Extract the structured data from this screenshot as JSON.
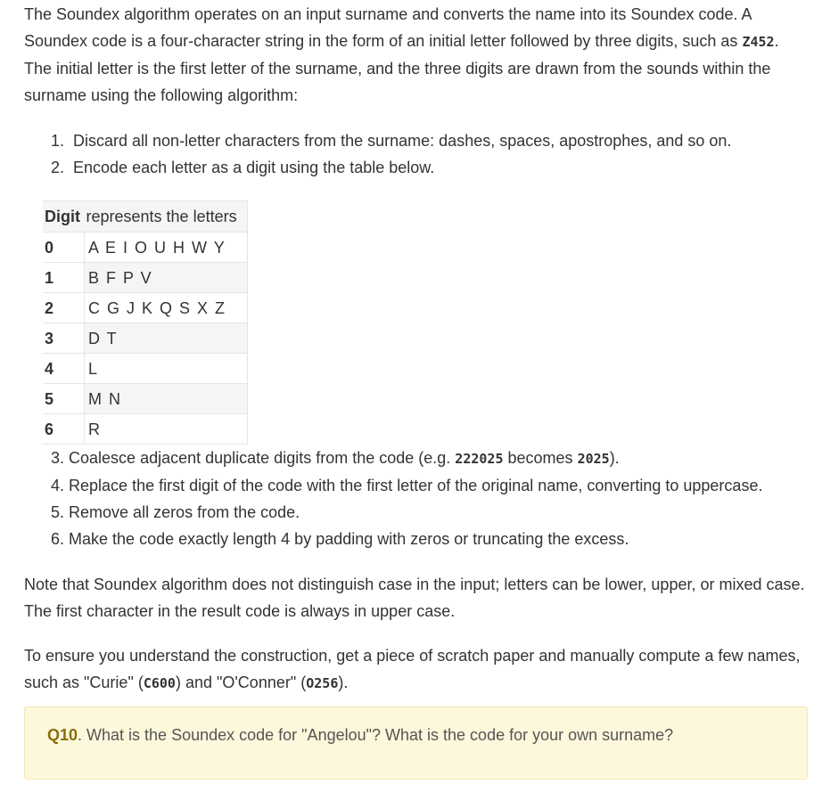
{
  "intro": {
    "p1": "The Soundex algorithm operates on an input surname and converts the name into its Soundex code. A Soundex code is a four-character string in the form of an initial letter followed by three digits, such as",
    "example_code": "Z452",
    "p2": ". The initial letter is the first letter of the surname, and the three digits are drawn from the sounds within the surname using the following algorithm:"
  },
  "steps_before": [
    {
      "num": "1.",
      "text": "Discard all non-letter characters from the surname: dashes, spaces, apostrophes, and so on."
    },
    {
      "num": "2.",
      "text": "Encode each letter as a digit using the table below."
    }
  ],
  "table": {
    "header_digit": "Digit",
    "header_letters": "represents the letters",
    "rows": [
      {
        "digit": "0",
        "letters": "A E I O U H W Y"
      },
      {
        "digit": "1",
        "letters": "B F P V"
      },
      {
        "digit": "2",
        "letters": "C G J K Q S X Z"
      },
      {
        "digit": "3",
        "letters": "D T"
      },
      {
        "digit": "4",
        "letters": "L"
      },
      {
        "digit": "5",
        "letters": "M N"
      },
      {
        "digit": "6",
        "letters": "R"
      }
    ]
  },
  "step3": {
    "num": "3.",
    "pre": "Coalesce adjacent duplicate digits from the code (e.g.",
    "code_a": "222025",
    "mid": "becomes",
    "code_b": "2025",
    "post": ")."
  },
  "steps_after": [
    {
      "num": "4.",
      "text": "Replace the first digit of the code with the first letter of the original name, converting to uppercase."
    },
    {
      "num": "5.",
      "text": "Remove all zeros from the code."
    },
    {
      "num": "6.",
      "text": "Make the code exactly length 4 by padding with zeros or truncating the excess."
    }
  ],
  "note": "Note that Soundex algorithm does not distinguish case in the input; letters can be lower, upper, or mixed case. The first character in the result code is always in upper case.",
  "scratch": {
    "pre": "To ensure you understand the construction, get a piece of scratch paper and manually compute a few names, such as \"Curie\" (",
    "code_a": "C600",
    "mid": ") and \"O'Conner\" (",
    "code_b": "O256",
    "post": ")."
  },
  "question": {
    "label": "Q10",
    "text": ". What is the Soundex code for \"Angelou\"? What is the code for your own surname?"
  }
}
